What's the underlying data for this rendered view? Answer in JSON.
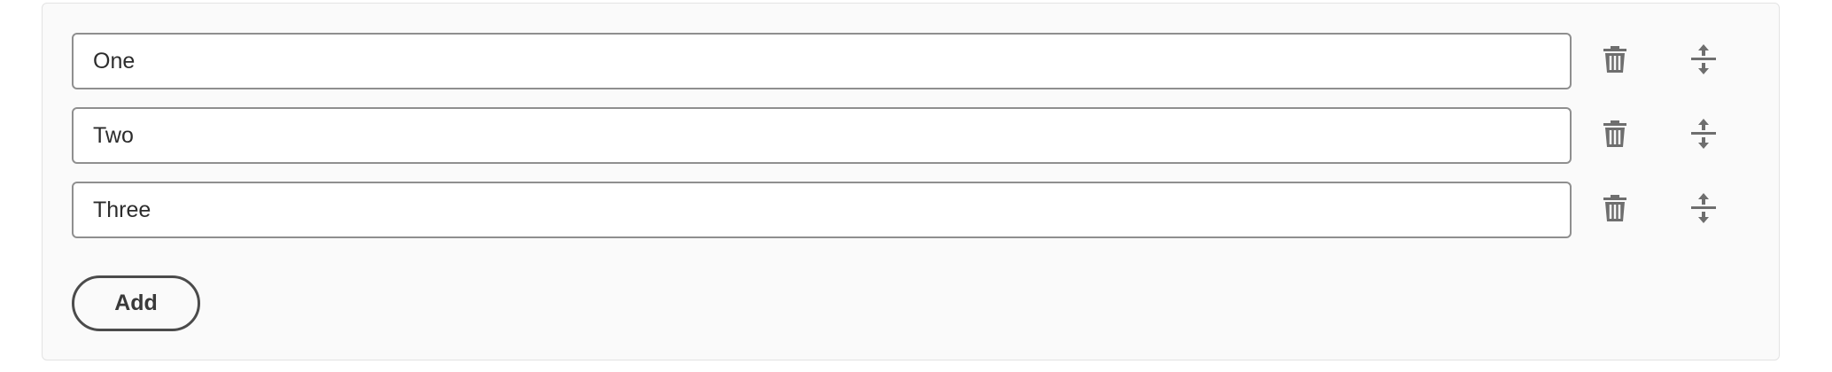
{
  "items": [
    {
      "value": "One"
    },
    {
      "value": "Two"
    },
    {
      "value": "Three"
    }
  ],
  "add_button": {
    "label": "Add"
  },
  "icons": {
    "delete": "trash-icon",
    "move": "move-vertical-icon"
  },
  "colors": {
    "icon": "#6e6e6e",
    "field_border": "#8f8f8f",
    "button_border": "#4b4b4b",
    "panel_bg": "#fafafa"
  }
}
